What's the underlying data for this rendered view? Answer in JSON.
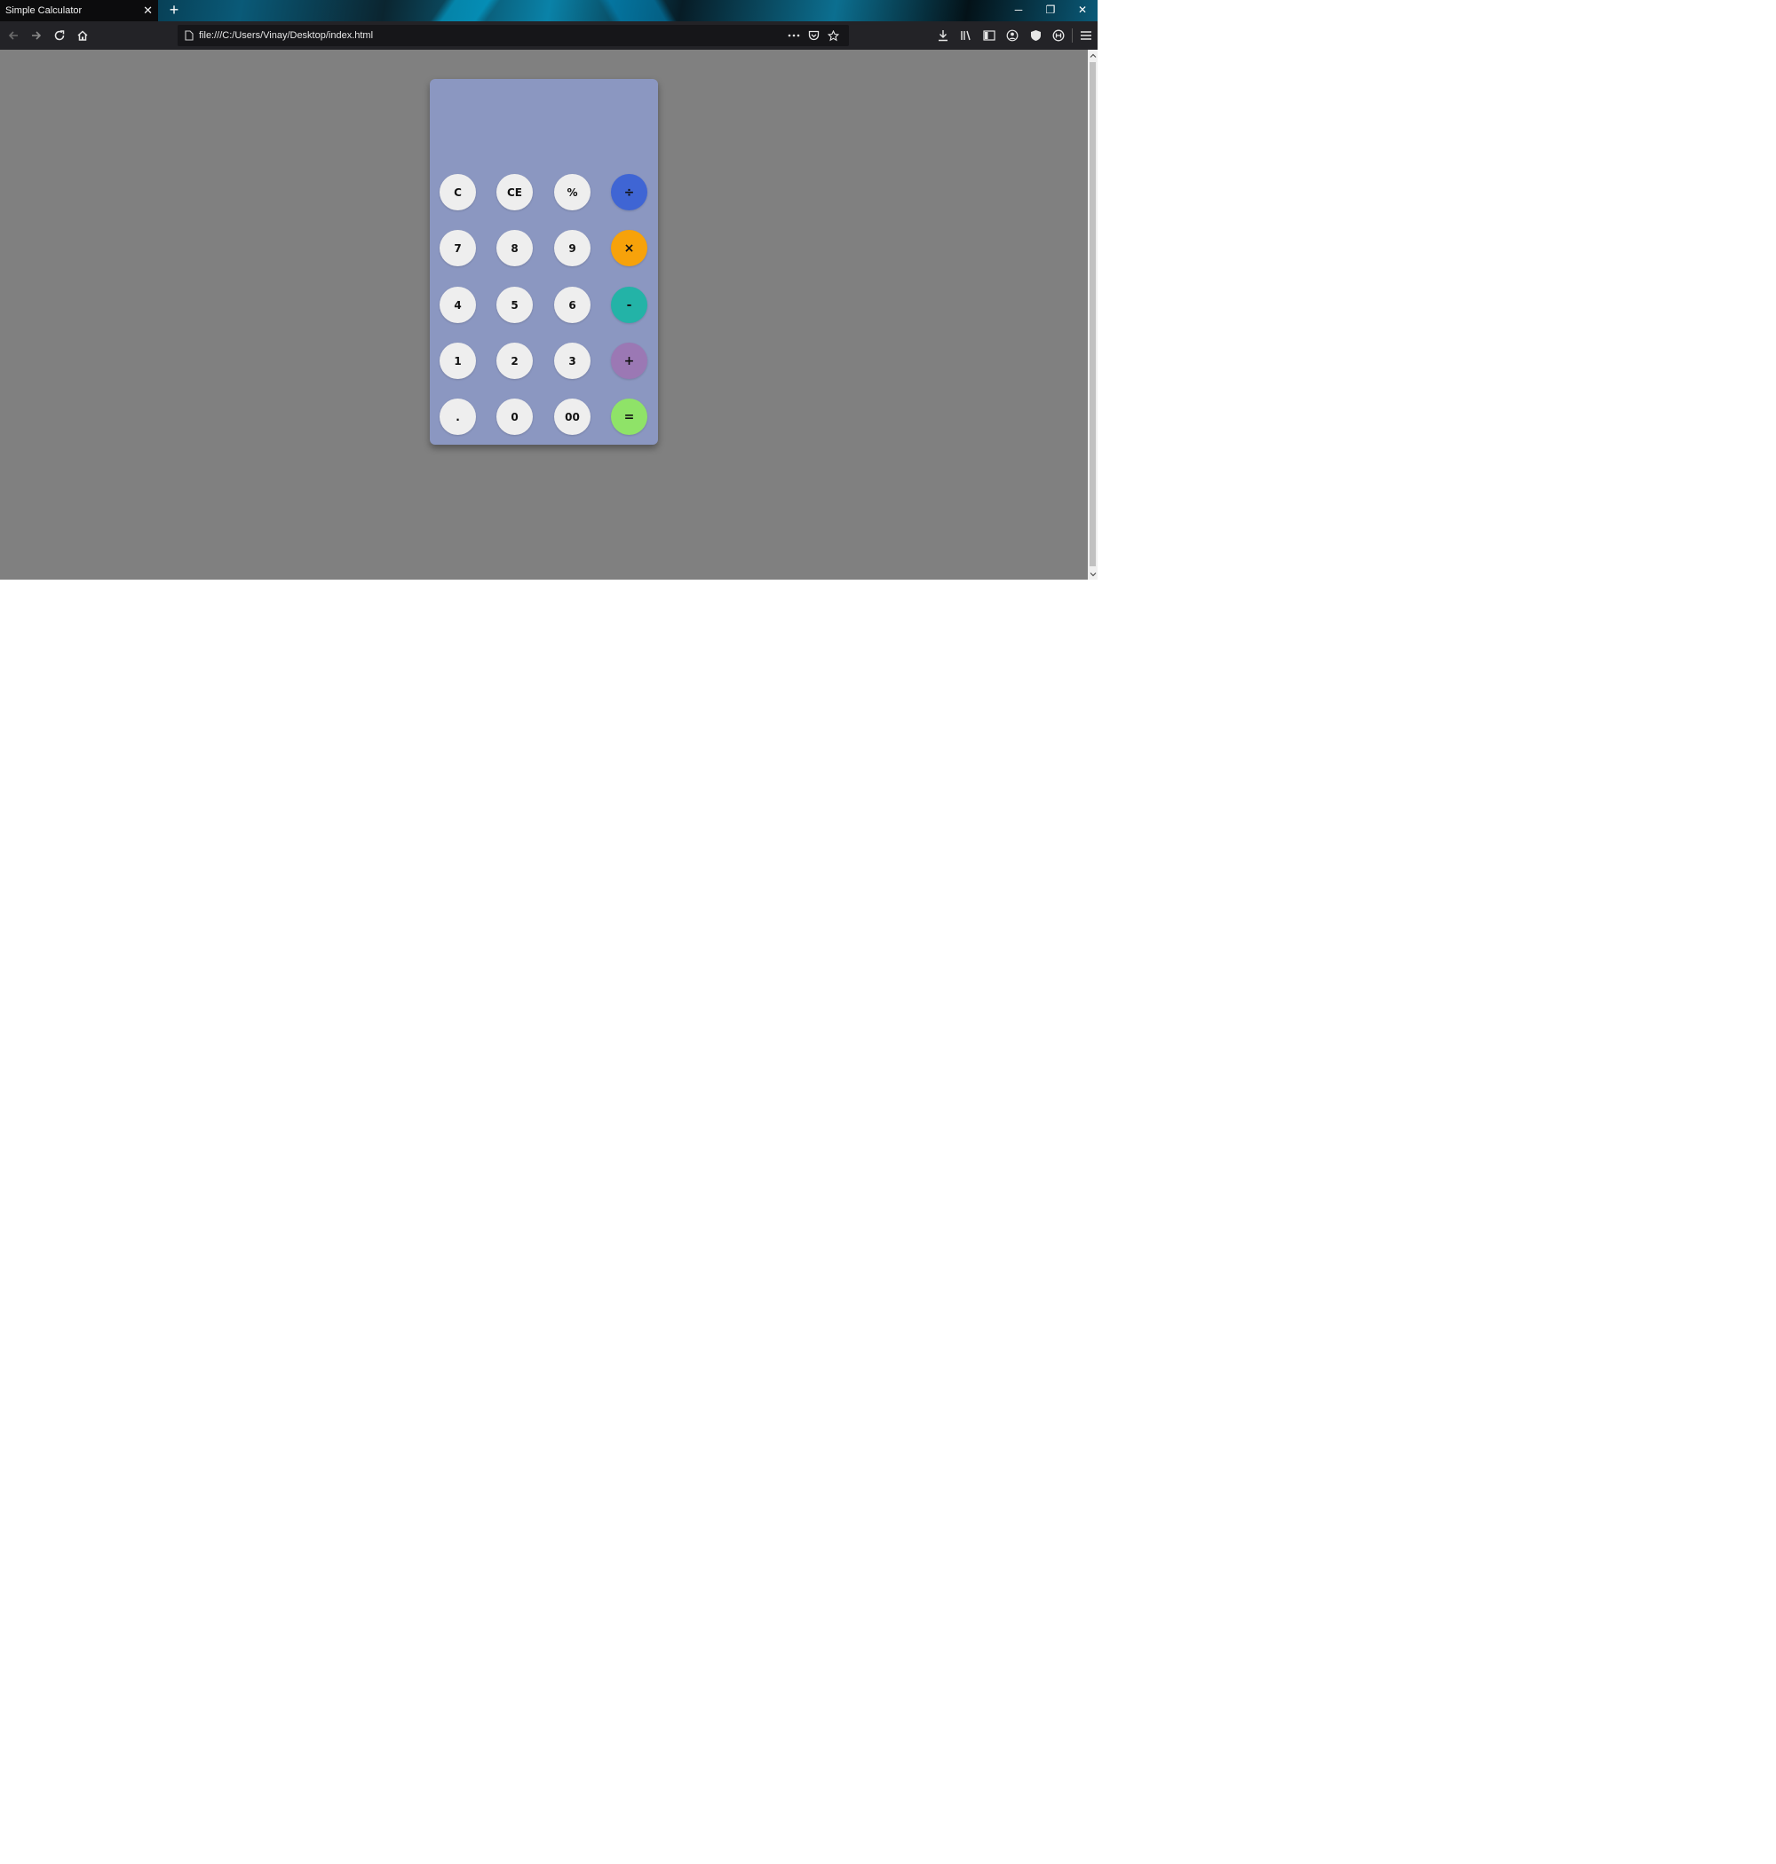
{
  "browser": {
    "tab_title": "Simple Calculator",
    "tab_close_label": "✕",
    "new_tab_label": "+",
    "url": "file:///C:/Users/Vinay/Desktop/index.html",
    "window_controls": {
      "minimize": "─",
      "restore": "❐",
      "close": "✕"
    }
  },
  "calculator": {
    "display_value": "",
    "keys": {
      "c": "C",
      "ce": "CE",
      "percent": "%",
      "divide": "÷",
      "seven": "7",
      "eight": "8",
      "nine": "9",
      "multiply": "×",
      "four": "4",
      "five": "5",
      "six": "6",
      "subtract": "-",
      "one": "1",
      "two": "2",
      "three": "3",
      "add": "+",
      "decimal": ".",
      "zero": "0",
      "double_zero": "00",
      "equals": "="
    },
    "colors": {
      "body": "#8b97c1",
      "key": "#eeeeee",
      "divide": "#3f65d4",
      "multiply": "#f7a20a",
      "subtract": "#23b3a7",
      "add": "#9b78b4",
      "equals": "#8fe368",
      "page_background": "#808080"
    }
  }
}
